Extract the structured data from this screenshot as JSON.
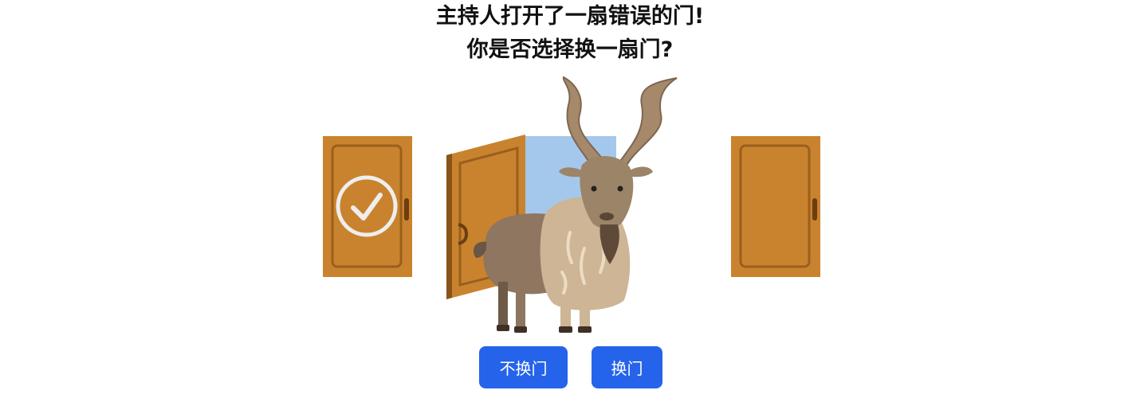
{
  "prompt": {
    "line1": "主持人打开了一扇错误的门!",
    "line2": "你是否选择换一扇门?"
  },
  "doors": [
    {
      "state": "closed",
      "selected": true,
      "mark_icon": "check-circle-icon"
    },
    {
      "state": "open",
      "revealed": "goat",
      "revealed_icon": "goat-icon"
    },
    {
      "state": "closed",
      "selected": false
    }
  ],
  "buttons": {
    "stay_label": "不换门",
    "switch_label": "换门"
  },
  "colors": {
    "door": "#c9832e",
    "door_dark": "#8a5418",
    "sky": "#a3c8ec",
    "button": "#2563eb",
    "check": "#eeeeee"
  }
}
